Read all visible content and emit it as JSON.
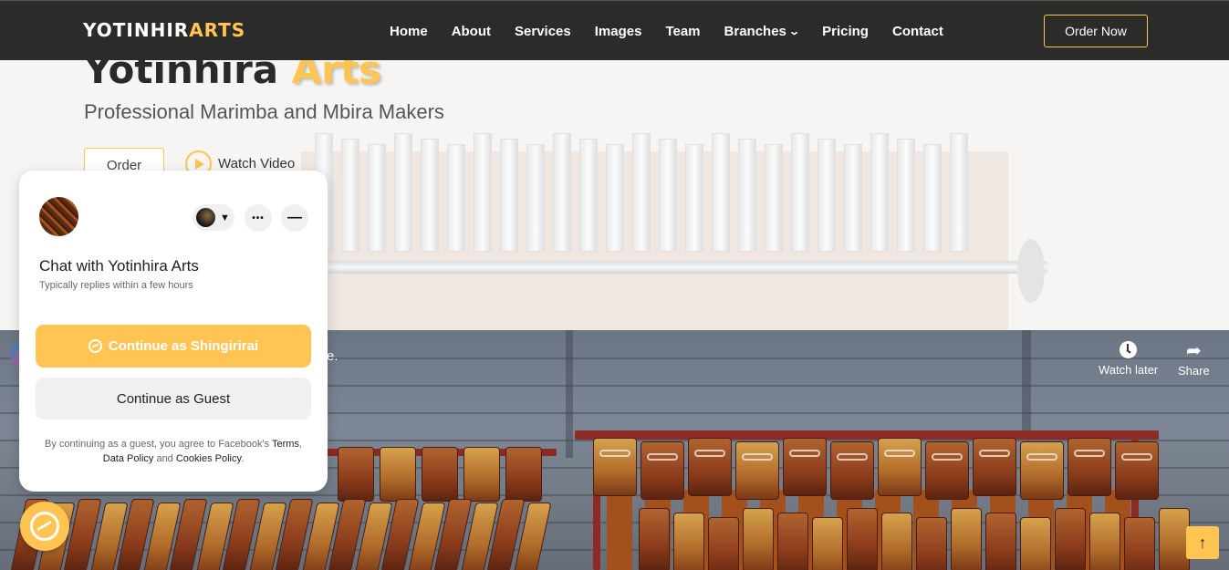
{
  "header": {
    "logo_main": "YOTINHIR",
    "logo_accent": "ARTS",
    "nav": [
      "Home",
      "About",
      "Services",
      "Images",
      "Team",
      "Branches",
      "Pricing",
      "Contact"
    ],
    "branches_chevron": "chevron-down-icon",
    "order_now": "Order Now"
  },
  "hero": {
    "title_main": "Yotinhira",
    "title_accent": "Arts",
    "subtitle": "Professional Marimba and Mbira Makers",
    "order_button": "Order",
    "watch_video": "Watch Video"
  },
  "video": {
    "title_fragment": "e.",
    "watch_later": "Watch later",
    "share": "Share"
  },
  "chat": {
    "title": "Chat with Yotinhira Arts",
    "subtitle": "Typically replies within a few hours",
    "more_label": "•••",
    "minimize_label": "—",
    "continue_as": "Continue as Shingirirai",
    "continue_guest": "Continue as Guest",
    "disclaimer_pre": "By continuing as a guest, you agree to Facebook's ",
    "terms": "Terms",
    "comma": ",",
    "data_policy": "Data Policy",
    "and": " and ",
    "cookies_policy": "Cookies Policy",
    "period": "."
  },
  "back_to_top": "↑",
  "colors": {
    "accent": "#ffc451",
    "header_bg": "#2b2b2a"
  }
}
